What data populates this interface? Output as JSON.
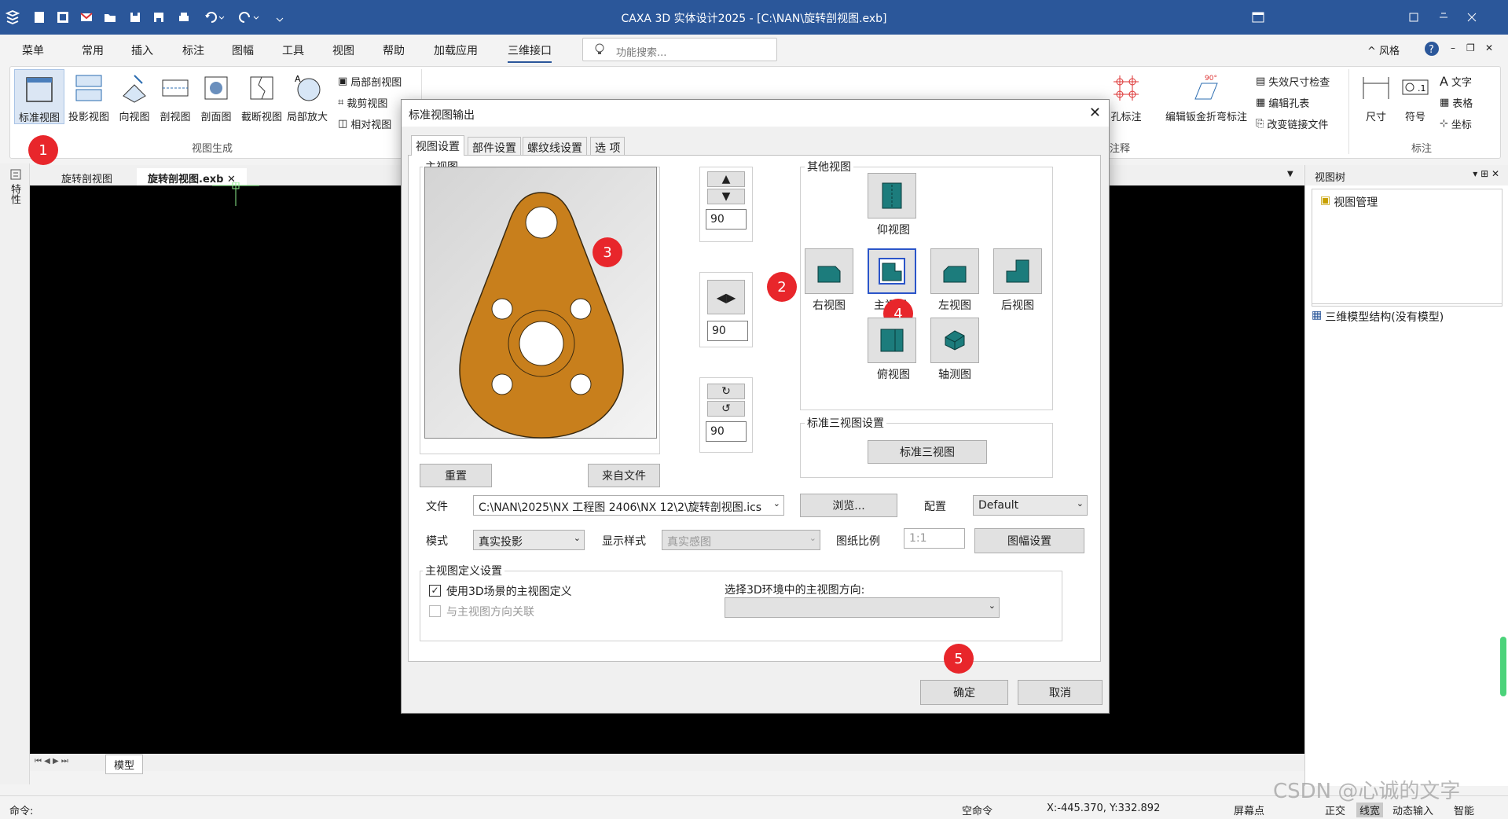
{
  "app": {
    "title": "CAXA 3D 实体设计2025 - [C:\\NAN\\旋转剖视图.exb]",
    "window_controls": [
      "minimize",
      "maximize",
      "close"
    ],
    "colors": {
      "titlebar": "#2b579a",
      "canvas": "#000000",
      "badge": "#e8262b",
      "part": "#c87f1c",
      "view_icon": "#1c7c7c"
    }
  },
  "menu": {
    "items": [
      "菜单",
      "常用",
      "插入",
      "标注",
      "图幅",
      "工具",
      "视图",
      "帮助",
      "加载应用",
      "三维接口"
    ],
    "active": "三维接口",
    "search_placeholder": "功能搜索...",
    "style_label": "风格"
  },
  "ribbon": {
    "view_gen_buttons": [
      "标准视图",
      "投影视图",
      "向视图",
      "剖视图",
      "剖面图",
      "截断视图",
      "局部放大"
    ],
    "view_gen_small": [
      "局部剖视图",
      "裁剪视图",
      "相对视图"
    ],
    "group_view_gen": "视图生成",
    "right_buttons": [
      "孔标注",
      "编辑钣金折弯标注"
    ],
    "right_small": [
      "失效尺寸检查",
      "编辑孔表",
      "改变链接文件"
    ],
    "group_annot": "注释",
    "dim_buttons": [
      "尺寸",
      "符号"
    ],
    "dim_small": [
      "文字",
      "表格",
      "坐标"
    ],
    "group_mark": "标注"
  },
  "left_bar": {
    "label": "特性"
  },
  "doc_tabs": [
    "旋转剖视图",
    "旋转剖视图.exb"
  ],
  "bottom_tabs": [
    "模型"
  ],
  "right_panel": {
    "title": "视图树",
    "tree1": "视图管理",
    "tree2": "三维模型结构(没有模型)"
  },
  "status": {
    "cmd_label": "命令:",
    "empty_cmd": "空命令",
    "coords": "X:-445.370, Y:332.892",
    "items": [
      "屏幕点",
      "正交",
      "线宽",
      "动态输入",
      "智能"
    ]
  },
  "dialog": {
    "title": "标准视图输出",
    "tabs": [
      "视图设置",
      "部件设置",
      "螺纹线设置",
      "选 项"
    ],
    "main_view_label": "主视图",
    "angle_up_down": "90",
    "angle_left_right": "90",
    "angle_rotate": "90",
    "reset_btn": "重置",
    "from_file_btn": "来自文件",
    "other_views_label": "其他视图",
    "views": {
      "bottom": "仰视图",
      "right": "右视图",
      "front": "主视图",
      "left": "左视图",
      "back": "后视图",
      "top": "俯视图",
      "iso": "轴测图"
    },
    "std3_group": "标准三视图设置",
    "std3_btn": "标准三视图",
    "file_label": "文件",
    "file_value": "C:\\NAN\\2025\\NX 工程图 2406\\NX 12\\2\\旋转剖视图.ics",
    "browse_btn": "浏览...",
    "config_label": "配置",
    "config_value": "Default",
    "mode_label": "模式",
    "mode_value": "真实投影",
    "display_label": "显示样式",
    "display_value": "真实感图",
    "scale_label": "图纸比例",
    "scale_value": "1:1",
    "sheet_btn": "图幅设置",
    "def_group": "主视图定义设置",
    "use3d_label": "使用3D场景的主视图定义",
    "use3d_checked": true,
    "link_label": "与主视图方向关联",
    "link_checked": false,
    "dir_label": "选择3D环境中的主视图方向:",
    "ok_btn": "确定",
    "cancel_btn": "取消"
  },
  "annotations": [
    "1",
    "2",
    "3",
    "4",
    "5"
  ],
  "watermark": "CSDN @心诚的文字"
}
